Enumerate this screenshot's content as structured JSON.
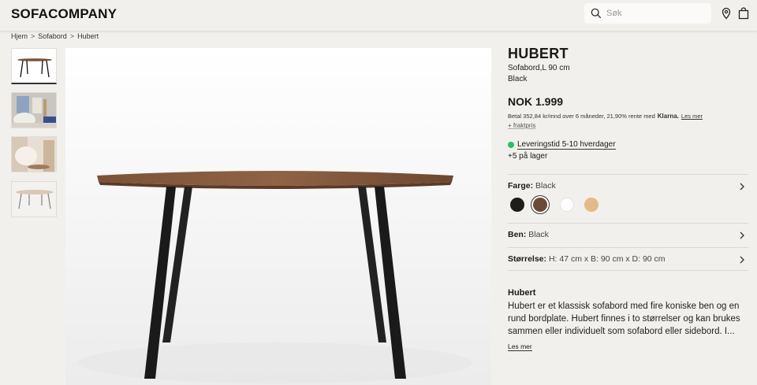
{
  "header": {
    "logo": "SOFACOMPANY",
    "search_placeholder": "Søk",
    "icons": [
      "search-icon",
      "location-pin-icon",
      "shopping-bag-icon"
    ]
  },
  "breadcrumb": [
    "Hjem",
    ">",
    "Sofabord",
    ">",
    "Hubert"
  ],
  "product": {
    "name": "HUBERT",
    "subtitle": "Sofabord,L 90 cm",
    "color": "Black",
    "price": "NOK 1.999",
    "klarna_text": "Betal 352,84 kr/mnd over 6 måneder, 21,90% rente med",
    "klarna_logo": "Klarna.",
    "klarna_link": "Les mer",
    "freight": "+ fraktpris",
    "delivery": "Leveringstid 5-10 hverdager",
    "stock": "+5 på lager",
    "delivery_color": "#2ebd6b"
  },
  "options": {
    "color_label": "Farge:",
    "color_value": "Black",
    "swatches": [
      "#1f1d1a",
      "#6b4a36",
      "#ffffff",
      "#e6b988"
    ],
    "legs_label": "Ben:",
    "legs_value": "Black",
    "size_label": "Størrelse:",
    "size_value": "H: 47 cm x B: 90 cm x D: 90 cm"
  },
  "description": {
    "title": "Hubert",
    "text": "Hubert er et klassisk sofabord med fire koniske ben og en rund bordplate. Hubert finnes i to størrelser og kan brukes sammen eller individuelt som sofabord eller sidebord. I...",
    "read_more": "Les mer"
  }
}
